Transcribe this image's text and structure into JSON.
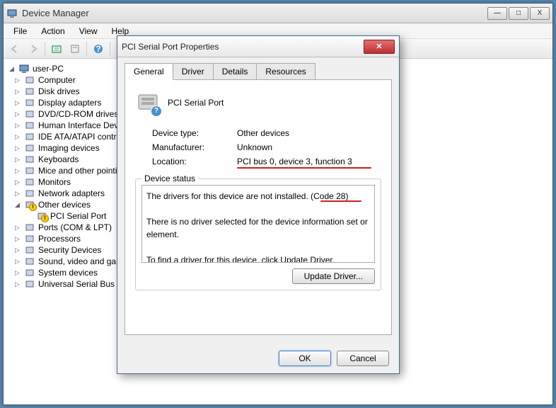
{
  "window": {
    "title": "Device Manager",
    "buttons": {
      "min": "—",
      "max": "□",
      "close": "X"
    }
  },
  "menu": {
    "file": "File",
    "action": "Action",
    "view": "View",
    "help": "Help"
  },
  "tree": {
    "root": "user-PC",
    "nodes": [
      "Computer",
      "Disk drives",
      "Display adapters",
      "DVD/CD-ROM drives",
      "Human Interface Devices",
      "IDE ATA/ATAPI controllers",
      "Imaging devices",
      "Keyboards",
      "Mice and other pointing devices",
      "Monitors",
      "Network adapters"
    ],
    "other_label": "Other devices",
    "other_child": "PCI Serial Port",
    "nodes2": [
      "Ports (COM & LPT)",
      "Processors",
      "Security Devices",
      "Sound, video and game controllers",
      "System devices",
      "Universal Serial Bus controllers"
    ]
  },
  "dialog": {
    "title": "PCI Serial Port Properties",
    "tabs": {
      "general": "General",
      "driver": "Driver",
      "details": "Details",
      "resources": "Resources"
    },
    "device_name": "PCI Serial Port",
    "rows": {
      "type_label": "Device type:",
      "type_value": "Other devices",
      "mfr_label": "Manufacturer:",
      "mfr_value": "Unknown",
      "loc_label": "Location:",
      "loc_value": "PCI bus 0, device 3, function 3"
    },
    "status": {
      "legend": "Device status",
      "line1": "The drivers for this device are not installed. (Code 28)",
      "line2": "There is no driver selected for the device information set or element.",
      "line3": "To find a driver for this device, click Update Driver."
    },
    "buttons": {
      "update": "Update Driver...",
      "ok": "OK",
      "cancel": "Cancel"
    }
  }
}
